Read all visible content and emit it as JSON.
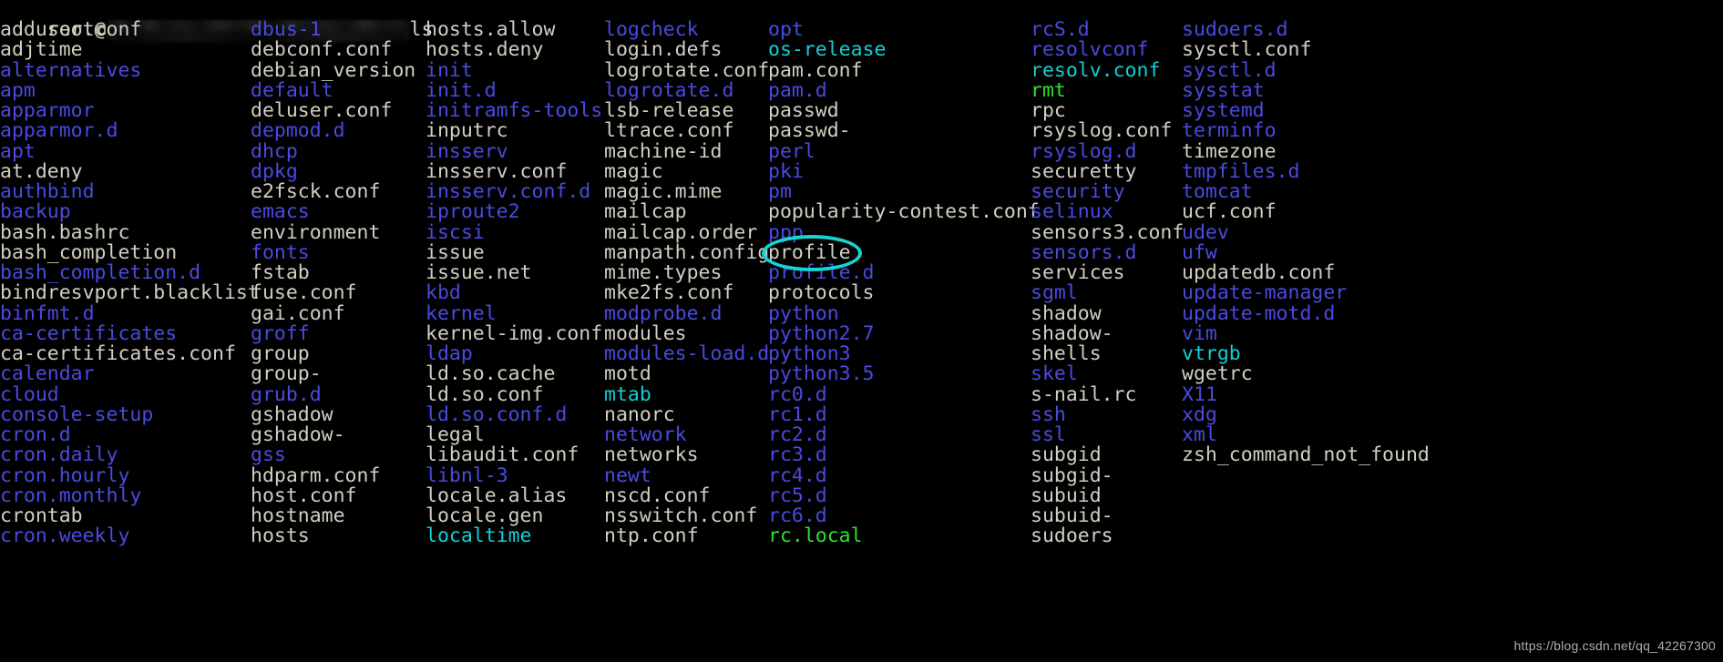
{
  "terminal": {
    "background_color": "#000000",
    "file_color": "#cfcfc2",
    "dir_color": "#4a4ae0",
    "link_color": "#13cfd4",
    "exec_color": "#2ee02e",
    "annotation_color": "#17d4d4"
  },
  "prompt": {
    "user_host": "root@",
    "redacted": true,
    "command": "ls"
  },
  "watermark": {
    "text": "https://blog.csdn.net/qq_42267300"
  },
  "annotation": {
    "type": "ellipse",
    "target_entry": "profile",
    "color": "#17d4d4"
  },
  "listing": {
    "columns": [
      {
        "index": 0,
        "entries": [
          {
            "name": "adduser.conf",
            "type": "file"
          },
          {
            "name": "adjtime",
            "type": "file"
          },
          {
            "name": "alternatives",
            "type": "dir"
          },
          {
            "name": "apm",
            "type": "dir"
          },
          {
            "name": "apparmor",
            "type": "dir"
          },
          {
            "name": "apparmor.d",
            "type": "dir"
          },
          {
            "name": "apt",
            "type": "dir"
          },
          {
            "name": "at.deny",
            "type": "file"
          },
          {
            "name": "authbind",
            "type": "dir"
          },
          {
            "name": "backup",
            "type": "dir"
          },
          {
            "name": "bash.bashrc",
            "type": "file"
          },
          {
            "name": "bash_completion",
            "type": "file"
          },
          {
            "name": "bash_completion.d",
            "type": "dir"
          },
          {
            "name": "bindresvport.blacklist",
            "type": "file"
          },
          {
            "name": "binfmt.d",
            "type": "dir"
          },
          {
            "name": "ca-certificates",
            "type": "dir"
          },
          {
            "name": "ca-certificates.conf",
            "type": "file"
          },
          {
            "name": "calendar",
            "type": "dir"
          },
          {
            "name": "cloud",
            "type": "dir"
          },
          {
            "name": "console-setup",
            "type": "dir"
          },
          {
            "name": "cron.d",
            "type": "dir"
          },
          {
            "name": "cron.daily",
            "type": "dir"
          },
          {
            "name": "cron.hourly",
            "type": "dir"
          },
          {
            "name": "cron.monthly",
            "type": "dir"
          },
          {
            "name": "crontab",
            "type": "file"
          },
          {
            "name": "cron.weekly",
            "type": "dir"
          }
        ]
      },
      {
        "index": 1,
        "entries": [
          {
            "name": "dbus-1",
            "type": "dir"
          },
          {
            "name": "debconf.conf",
            "type": "file"
          },
          {
            "name": "debian_version",
            "type": "file"
          },
          {
            "name": "default",
            "type": "dir"
          },
          {
            "name": "deluser.conf",
            "type": "file"
          },
          {
            "name": "depmod.d",
            "type": "dir"
          },
          {
            "name": "dhcp",
            "type": "dir"
          },
          {
            "name": "dpkg",
            "type": "dir"
          },
          {
            "name": "e2fsck.conf",
            "type": "file"
          },
          {
            "name": "emacs",
            "type": "dir"
          },
          {
            "name": "environment",
            "type": "file"
          },
          {
            "name": "fonts",
            "type": "dir"
          },
          {
            "name": "fstab",
            "type": "file"
          },
          {
            "name": "fuse.conf",
            "type": "file"
          },
          {
            "name": "gai.conf",
            "type": "file"
          },
          {
            "name": "groff",
            "type": "dir"
          },
          {
            "name": "group",
            "type": "file"
          },
          {
            "name": "group-",
            "type": "file"
          },
          {
            "name": "grub.d",
            "type": "dir"
          },
          {
            "name": "gshadow",
            "type": "file"
          },
          {
            "name": "gshadow-",
            "type": "file"
          },
          {
            "name": "gss",
            "type": "dir"
          },
          {
            "name": "hdparm.conf",
            "type": "file"
          },
          {
            "name": "host.conf",
            "type": "file"
          },
          {
            "name": "hostname",
            "type": "file"
          },
          {
            "name": "hosts",
            "type": "file"
          }
        ]
      },
      {
        "index": 2,
        "entries": [
          {
            "name": "hosts.allow",
            "type": "file"
          },
          {
            "name": "hosts.deny",
            "type": "file"
          },
          {
            "name": "init",
            "type": "dir"
          },
          {
            "name": "init.d",
            "type": "dir"
          },
          {
            "name": "initramfs-tools",
            "type": "dir"
          },
          {
            "name": "inputrc",
            "type": "file"
          },
          {
            "name": "insserv",
            "type": "dir"
          },
          {
            "name": "insserv.conf",
            "type": "file"
          },
          {
            "name": "insserv.conf.d",
            "type": "dir"
          },
          {
            "name": "iproute2",
            "type": "dir"
          },
          {
            "name": "iscsi",
            "type": "dir"
          },
          {
            "name": "issue",
            "type": "file"
          },
          {
            "name": "issue.net",
            "type": "file"
          },
          {
            "name": "kbd",
            "type": "dir"
          },
          {
            "name": "kernel",
            "type": "dir"
          },
          {
            "name": "kernel-img.conf",
            "type": "file"
          },
          {
            "name": "ldap",
            "type": "dir"
          },
          {
            "name": "ld.so.cache",
            "type": "file"
          },
          {
            "name": "ld.so.conf",
            "type": "file"
          },
          {
            "name": "ld.so.conf.d",
            "type": "dir"
          },
          {
            "name": "legal",
            "type": "file"
          },
          {
            "name": "libaudit.conf",
            "type": "file"
          },
          {
            "name": "libnl-3",
            "type": "dir"
          },
          {
            "name": "locale.alias",
            "type": "file"
          },
          {
            "name": "locale.gen",
            "type": "file"
          },
          {
            "name": "localtime",
            "type": "link"
          }
        ]
      },
      {
        "index": 3,
        "entries": [
          {
            "name": "logcheck",
            "type": "dir"
          },
          {
            "name": "login.defs",
            "type": "file"
          },
          {
            "name": "logrotate.conf",
            "type": "file"
          },
          {
            "name": "logrotate.d",
            "type": "dir"
          },
          {
            "name": "lsb-release",
            "type": "file"
          },
          {
            "name": "ltrace.conf",
            "type": "file"
          },
          {
            "name": "machine-id",
            "type": "file"
          },
          {
            "name": "magic",
            "type": "file"
          },
          {
            "name": "magic.mime",
            "type": "file"
          },
          {
            "name": "mailcap",
            "type": "file"
          },
          {
            "name": "mailcap.order",
            "type": "file"
          },
          {
            "name": "manpath.config",
            "type": "file"
          },
          {
            "name": "mime.types",
            "type": "file"
          },
          {
            "name": "mke2fs.conf",
            "type": "file"
          },
          {
            "name": "modprobe.d",
            "type": "dir"
          },
          {
            "name": "modules",
            "type": "file"
          },
          {
            "name": "modules-load.d",
            "type": "dir"
          },
          {
            "name": "motd",
            "type": "file"
          },
          {
            "name": "mtab",
            "type": "link"
          },
          {
            "name": "nanorc",
            "type": "file"
          },
          {
            "name": "network",
            "type": "dir"
          },
          {
            "name": "networks",
            "type": "file"
          },
          {
            "name": "newt",
            "type": "dir"
          },
          {
            "name": "nscd.conf",
            "type": "file"
          },
          {
            "name": "nsswitch.conf",
            "type": "file"
          },
          {
            "name": "ntp.conf",
            "type": "file"
          }
        ]
      },
      {
        "index": 4,
        "entries": [
          {
            "name": "opt",
            "type": "dir"
          },
          {
            "name": "os-release",
            "type": "link"
          },
          {
            "name": "pam.conf",
            "type": "file"
          },
          {
            "name": "pam.d",
            "type": "dir"
          },
          {
            "name": "passwd",
            "type": "file"
          },
          {
            "name": "passwd-",
            "type": "file"
          },
          {
            "name": "perl",
            "type": "dir"
          },
          {
            "name": "pki",
            "type": "dir"
          },
          {
            "name": "pm",
            "type": "dir"
          },
          {
            "name": "popularity-contest.conf",
            "type": "file"
          },
          {
            "name": "ppp",
            "type": "dir"
          },
          {
            "name": "profile",
            "type": "file",
            "annotated": true
          },
          {
            "name": "profile.d",
            "type": "dir"
          },
          {
            "name": "protocols",
            "type": "file"
          },
          {
            "name": "python",
            "type": "dir"
          },
          {
            "name": "python2.7",
            "type": "dir"
          },
          {
            "name": "python3",
            "type": "dir"
          },
          {
            "name": "python3.5",
            "type": "dir"
          },
          {
            "name": "rc0.d",
            "type": "dir"
          },
          {
            "name": "rc1.d",
            "type": "dir"
          },
          {
            "name": "rc2.d",
            "type": "dir"
          },
          {
            "name": "rc3.d",
            "type": "dir"
          },
          {
            "name": "rc4.d",
            "type": "dir"
          },
          {
            "name": "rc5.d",
            "type": "dir"
          },
          {
            "name": "rc6.d",
            "type": "dir"
          },
          {
            "name": "rc.local",
            "type": "exec"
          }
        ]
      },
      {
        "index": 5,
        "entries": [
          {
            "name": "rcS.d",
            "type": "dir"
          },
          {
            "name": "resolvconf",
            "type": "dir"
          },
          {
            "name": "resolv.conf",
            "type": "link"
          },
          {
            "name": "rmt",
            "type": "exec"
          },
          {
            "name": "rpc",
            "type": "file"
          },
          {
            "name": "rsyslog.conf",
            "type": "file"
          },
          {
            "name": "rsyslog.d",
            "type": "dir"
          },
          {
            "name": "securetty",
            "type": "file"
          },
          {
            "name": "security",
            "type": "dir"
          },
          {
            "name": "selinux",
            "type": "dir"
          },
          {
            "name": "sensors3.conf",
            "type": "file"
          },
          {
            "name": "sensors.d",
            "type": "dir"
          },
          {
            "name": "services",
            "type": "file"
          },
          {
            "name": "sgml",
            "type": "dir"
          },
          {
            "name": "shadow",
            "type": "file"
          },
          {
            "name": "shadow-",
            "type": "file"
          },
          {
            "name": "shells",
            "type": "file"
          },
          {
            "name": "skel",
            "type": "dir"
          },
          {
            "name": "s-nail.rc",
            "type": "file"
          },
          {
            "name": "ssh",
            "type": "dir"
          },
          {
            "name": "ssl",
            "type": "dir"
          },
          {
            "name": "subgid",
            "type": "file"
          },
          {
            "name": "subgid-",
            "type": "file"
          },
          {
            "name": "subuid",
            "type": "file"
          },
          {
            "name": "subuid-",
            "type": "file"
          },
          {
            "name": "sudoers",
            "type": "file"
          }
        ]
      },
      {
        "index": 6,
        "entries": [
          {
            "name": "sudoers.d",
            "type": "dir"
          },
          {
            "name": "sysctl.conf",
            "type": "file"
          },
          {
            "name": "sysctl.d",
            "type": "dir"
          },
          {
            "name": "sysstat",
            "type": "dir"
          },
          {
            "name": "systemd",
            "type": "dir"
          },
          {
            "name": "terminfo",
            "type": "dir"
          },
          {
            "name": "timezone",
            "type": "file"
          },
          {
            "name": "tmpfiles.d",
            "type": "dir"
          },
          {
            "name": "tomcat",
            "type": "dir"
          },
          {
            "name": "ucf.conf",
            "type": "file"
          },
          {
            "name": "udev",
            "type": "dir"
          },
          {
            "name": "ufw",
            "type": "dir"
          },
          {
            "name": "updatedb.conf",
            "type": "file"
          },
          {
            "name": "update-manager",
            "type": "dir"
          },
          {
            "name": "update-motd.d",
            "type": "dir"
          },
          {
            "name": "vim",
            "type": "dir"
          },
          {
            "name": "vtrgb",
            "type": "link"
          },
          {
            "name": "wgetrc",
            "type": "file"
          },
          {
            "name": "X11",
            "type": "dir"
          },
          {
            "name": "xdg",
            "type": "dir"
          },
          {
            "name": "xml",
            "type": "dir"
          },
          {
            "name": "zsh_command_not_found",
            "type": "file"
          }
        ]
      }
    ]
  }
}
